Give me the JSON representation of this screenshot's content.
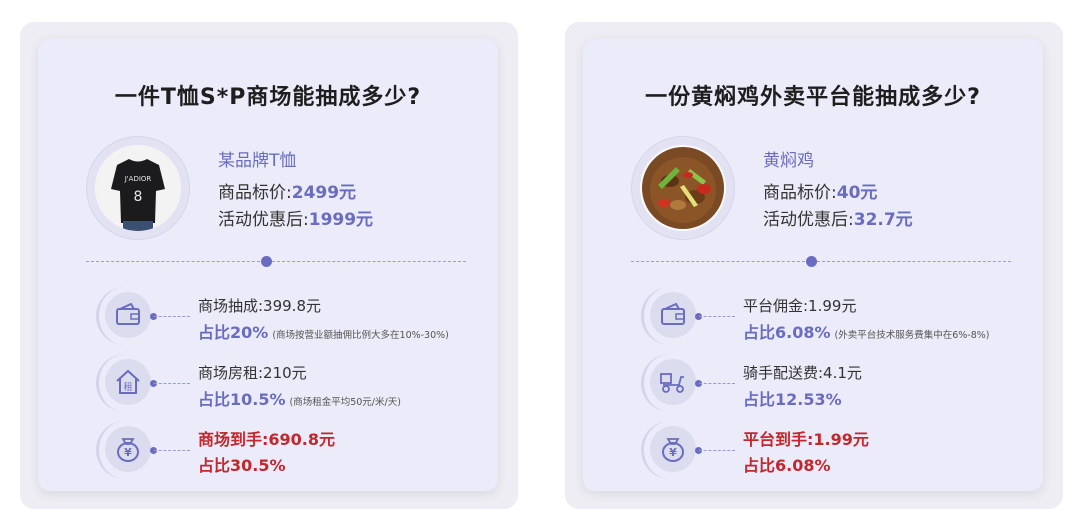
{
  "left": {
    "title": "一件T恤S*P商场能抽成多少?",
    "product_name": "某品牌T恤",
    "price_label": "商品标价:",
    "price_value": "2499元",
    "discount_label": "活动优惠后:",
    "discount_value": "1999元",
    "shirt_text": "J'ADIOR",
    "shirt_number": "8",
    "rows": [
      {
        "icon": "wallet-icon",
        "label": "商场抽成:399.8元",
        "share": "占比20%",
        "note": "(商场按营业额抽佣比例大多在10%-30%)"
      },
      {
        "icon": "house-rent-icon",
        "label": "商场房租:210元",
        "share": "占比10.5%",
        "note": "(商场租金平均50元/米/天)"
      },
      {
        "icon": "money-bag-icon",
        "label": "商场到手:690.8元",
        "share": "占比30.5%",
        "note": ""
      }
    ],
    "rent_glyph": "租",
    "yen_glyph": "¥"
  },
  "right": {
    "title": "一份黄焖鸡外卖平台能抽成多少?",
    "product_name": "黄焖鸡",
    "price_label": "商品标价:",
    "price_value": "40元",
    "discount_label": "活动优惠后:",
    "discount_value": "32.7元",
    "rows": [
      {
        "icon": "wallet-icon",
        "label": "平台佣金:1.99元",
        "share": "占比6.08%",
        "note": "(外卖平台技术服务费集中在6%-8%)"
      },
      {
        "icon": "scooter-icon",
        "label": "骑手配送费:4.1元",
        "share": "占比12.53%",
        "note": ""
      },
      {
        "icon": "money-bag-icon",
        "label": "平台到手:1.99元",
        "share": "占比6.08%",
        "note": ""
      }
    ],
    "yen_glyph": "¥"
  },
  "colors": {
    "accent": "#6a6cc0",
    "highlight_red": "#c1272d",
    "card_bg": "#ebebf9",
    "outer_bg": "#ededf3"
  }
}
